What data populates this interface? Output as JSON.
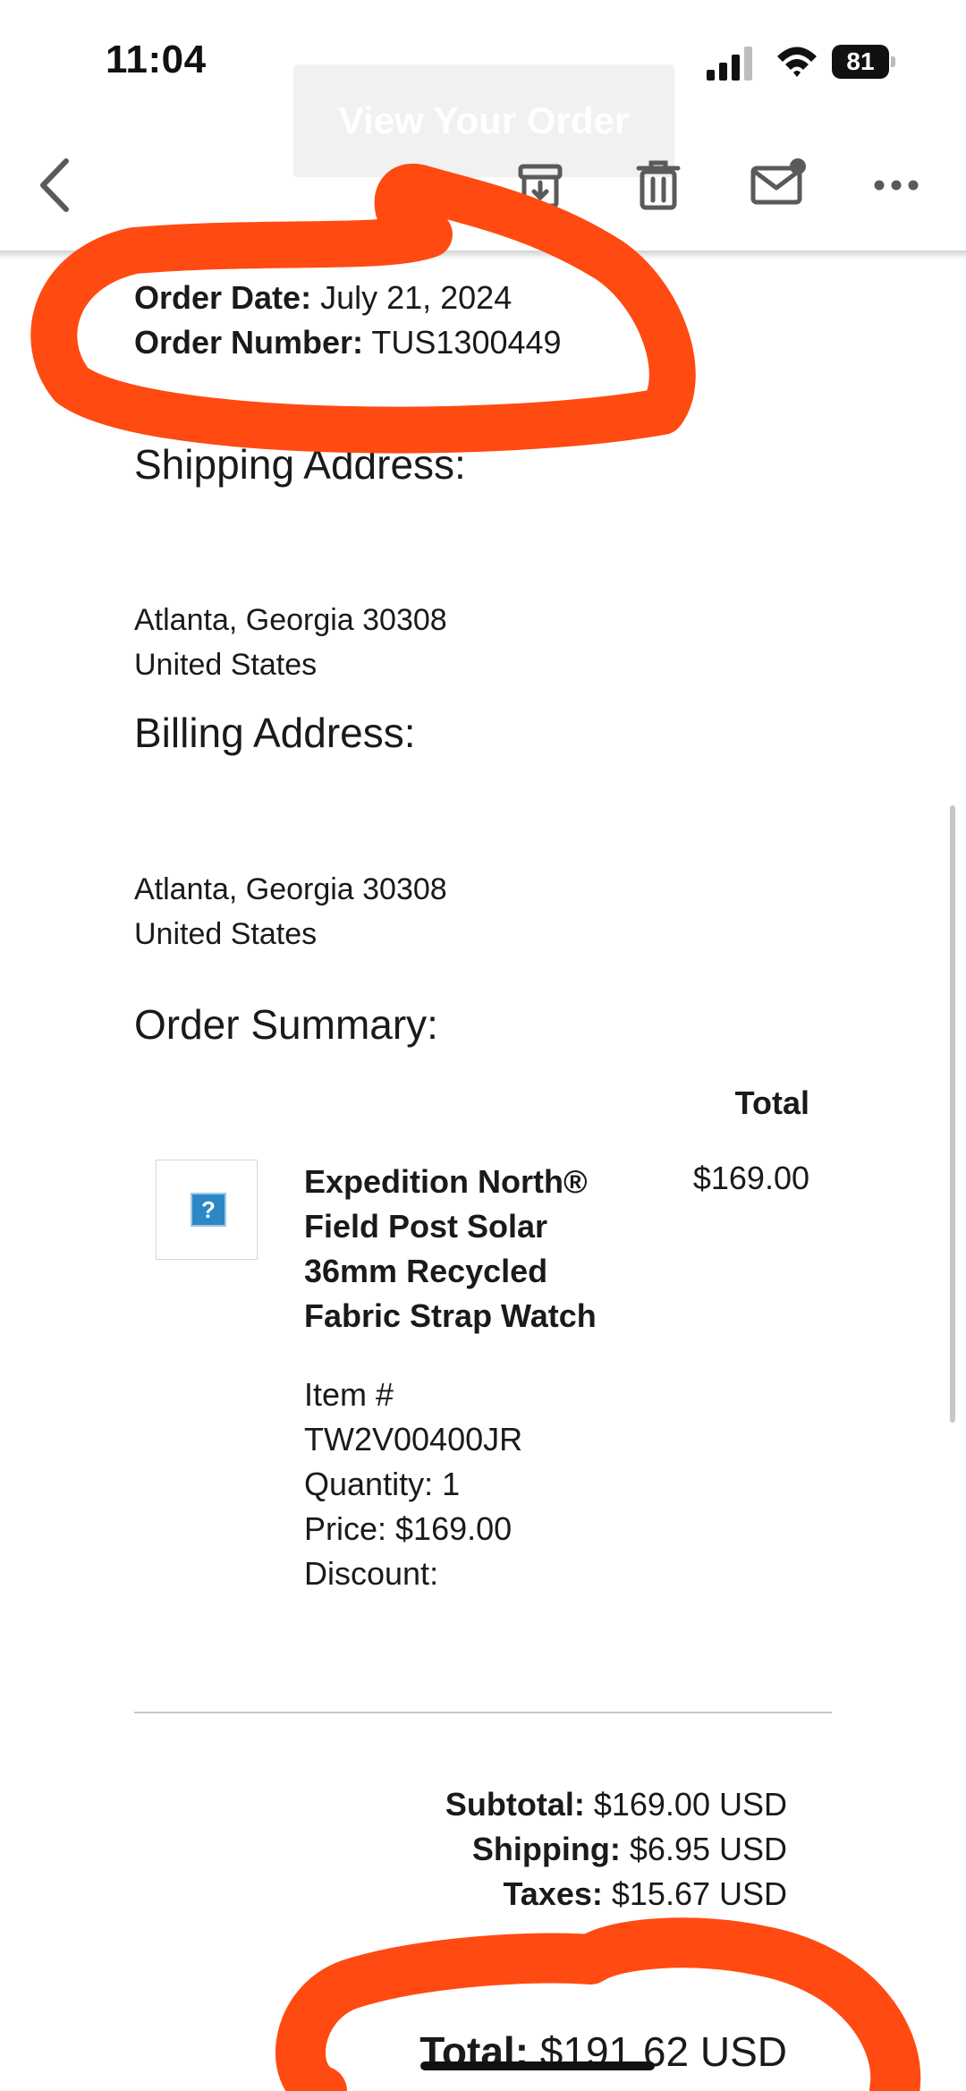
{
  "status_bar": {
    "time": "11:04",
    "battery": "81"
  },
  "ghost_header": {
    "label": "View Your Order"
  },
  "toolbar": {
    "icons": [
      "chevron-left-icon",
      "archive-icon",
      "trash-icon",
      "mail-unread-icon",
      "more-icon"
    ]
  },
  "order": {
    "date_label": "Order Date:",
    "date_value": " July 21, 2024",
    "number_label": "Order Number:",
    "number_value": " TUS1300449"
  },
  "shipping": {
    "heading": "Shipping Address:",
    "line1": "Atlanta, Georgia 30308",
    "line2": "United States"
  },
  "billing": {
    "heading": "Billing Address:",
    "line1": "Atlanta, Georgia 30308",
    "line2": "United States"
  },
  "summary": {
    "heading": "Order Summary:",
    "total_col": "Total",
    "item": {
      "image_placeholder": "?",
      "name": "Expedition North® Field Post Solar 36mm Recycled Fabric Strap Watch",
      "price": "$169.00",
      "item_no_label": "Item #",
      "item_no": "TW2V00400JR",
      "quantity": "Quantity: 1",
      "unit_price": "Price: $169.00",
      "discount": "Discount:"
    },
    "subtotal_label": "Subtotal:",
    "subtotal_value": " $169.00 USD",
    "shipping_label": "Shipping:",
    "shipping_value": " $6.95 USD",
    "taxes_label": "Taxes:",
    "taxes_value": " $15.67 USD",
    "total_label": "Total:",
    "total_value": " $191.62 USD"
  },
  "colors": {
    "marker": "#ff4a12",
    "text": "#1a1a1a",
    "thumb_blue": "#2c88c5"
  }
}
